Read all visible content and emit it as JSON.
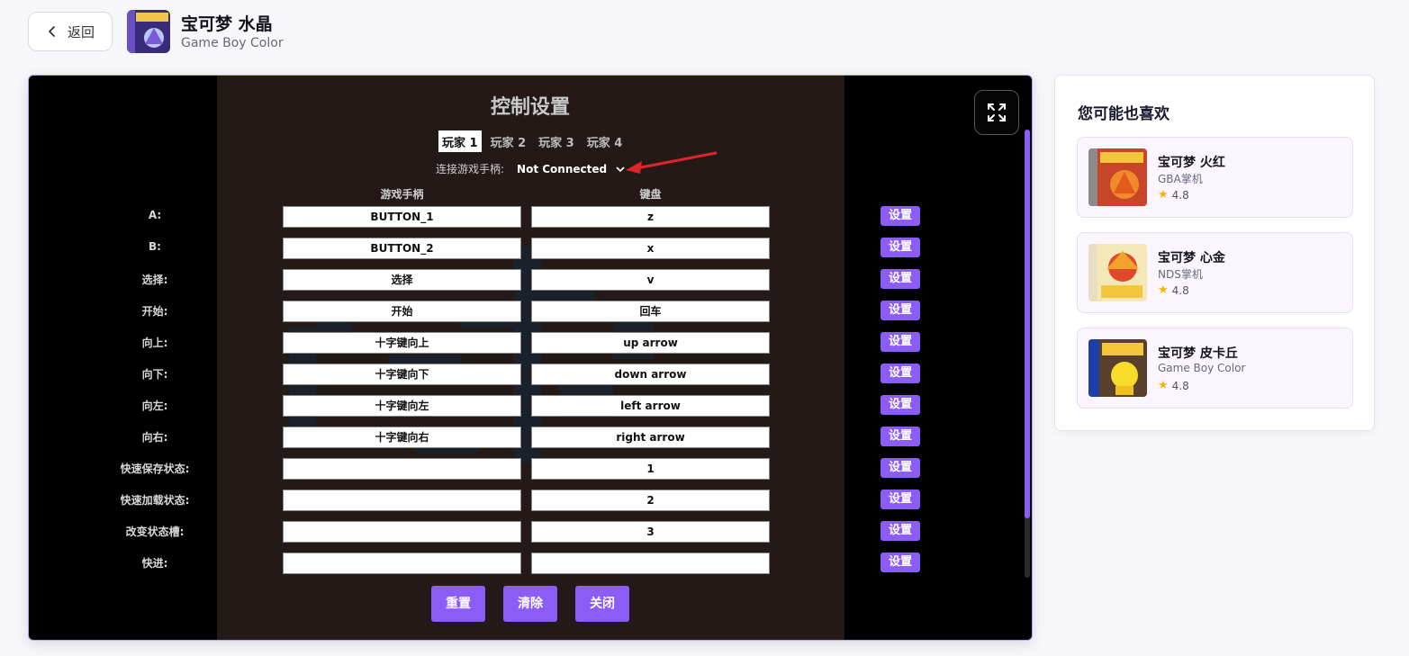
{
  "header": {
    "back_label": "返回",
    "game_title": "宝可梦 水晶",
    "game_platform": "Game Boy Color"
  },
  "controls": {
    "title": "控制设置",
    "tabs": [
      "玩家 1",
      "玩家 2",
      "玩家 3",
      "玩家 4"
    ],
    "active_tab": 0,
    "gamepad_label": "连接游戏手柄:",
    "gamepad_value": "Not Connected",
    "col_gamepad": "游戏手柄",
    "col_keyboard": "键盘",
    "set_label": "设置",
    "rows": [
      {
        "label": "A:",
        "gamepad": "BUTTON_1",
        "keyboard": "z"
      },
      {
        "label": "B:",
        "gamepad": "BUTTON_2",
        "keyboard": "x"
      },
      {
        "label": "选择:",
        "gamepad": "选择",
        "keyboard": "v"
      },
      {
        "label": "开始:",
        "gamepad": "开始",
        "keyboard": "回车"
      },
      {
        "label": "向上:",
        "gamepad": "十字键向上",
        "keyboard": "up arrow"
      },
      {
        "label": "向下:",
        "gamepad": "十字键向下",
        "keyboard": "down arrow"
      },
      {
        "label": "向左:",
        "gamepad": "十字键向左",
        "keyboard": "left arrow"
      },
      {
        "label": "向右:",
        "gamepad": "十字键向右",
        "keyboard": "right arrow"
      },
      {
        "label": "快速保存状态:",
        "gamepad": "",
        "keyboard": "1"
      },
      {
        "label": "快速加载状态:",
        "gamepad": "",
        "keyboard": "2"
      },
      {
        "label": "改变状态槽:",
        "gamepad": "",
        "keyboard": "3"
      },
      {
        "label": "快进:",
        "gamepad": "",
        "keyboard": ""
      }
    ],
    "reset_label": "重置",
    "clear_label": "清除",
    "close_label": "关闭"
  },
  "sidebar": {
    "title": "您可能也喜欢",
    "items": [
      {
        "name": "宝可梦 火红",
        "platform": "GBA掌机",
        "rating": "4.8"
      },
      {
        "name": "宝可梦 心金",
        "platform": "NDS掌机",
        "rating": "4.8"
      },
      {
        "name": "宝可梦 皮卡丘",
        "platform": "Game Boy Color",
        "rating": "4.8"
      }
    ]
  },
  "colors": {
    "accent": "#8b5cf6",
    "annotation_arrow": "#e0242b"
  }
}
